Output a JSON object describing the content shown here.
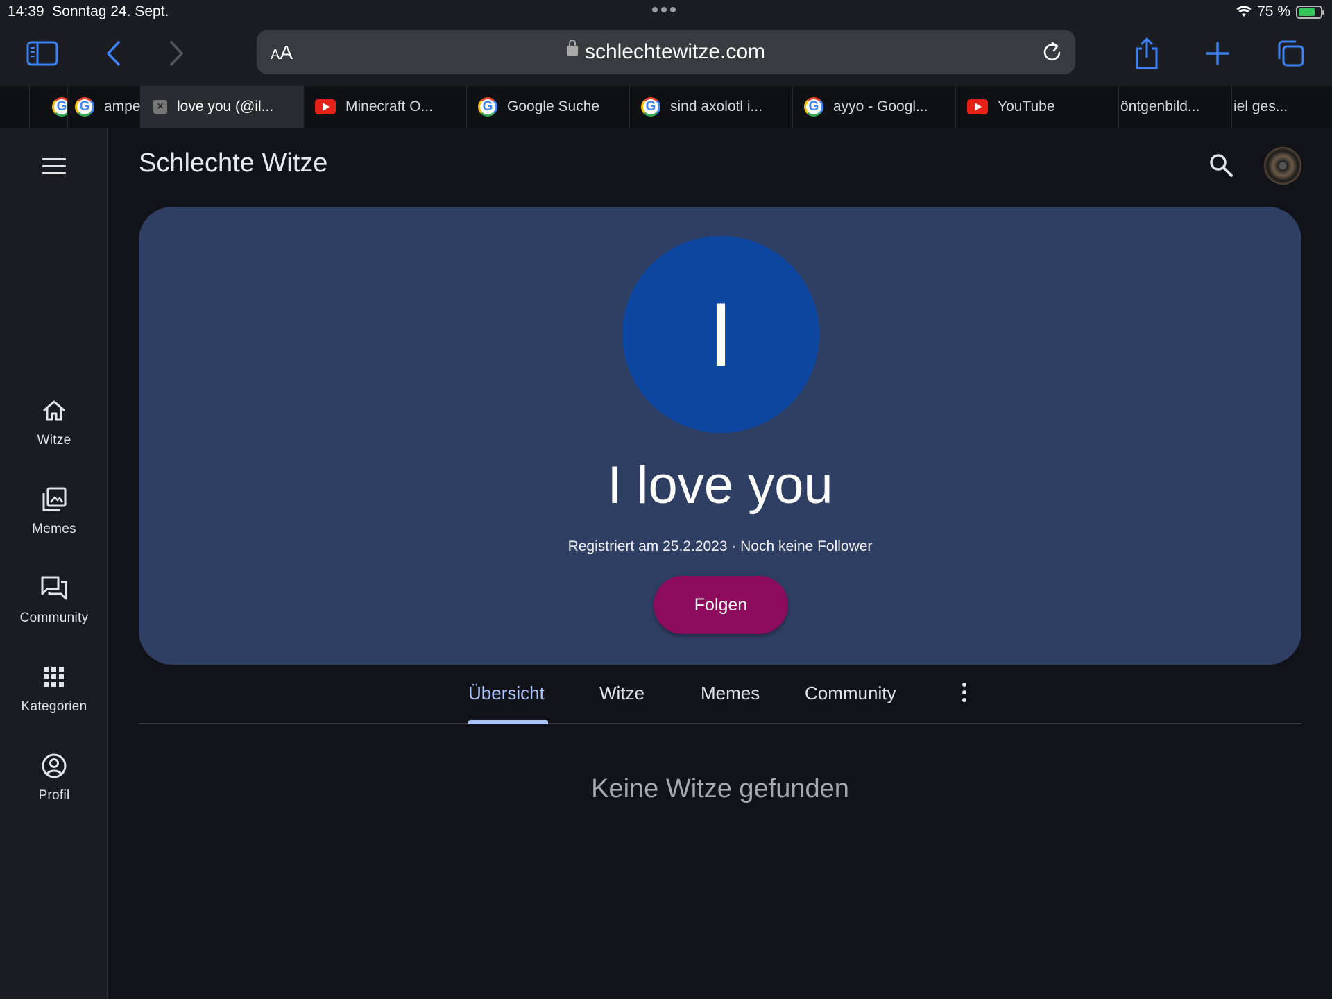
{
  "status_bar": {
    "time": "14:39",
    "date": "Sonntag 24. Sept.",
    "battery": "75 %",
    "battery_level": 0.75
  },
  "browser": {
    "address_text_size": "AA",
    "url": "schlechtewitze.com",
    "tabs": [
      {
        "label": "",
        "icon": "google-icon"
      },
      {
        "label": "ampe",
        "icon": "google-icon"
      },
      {
        "label": "love you (@il...",
        "icon": "close-icon",
        "active": true
      },
      {
        "label": "Minecraft O...",
        "icon": "youtube-icon"
      },
      {
        "label": "Google Suche",
        "icon": "google-icon"
      },
      {
        "label": "sind axolotl i...",
        "icon": "google-icon"
      },
      {
        "label": "ayyo - Googl...",
        "icon": "google-icon"
      },
      {
        "label": "YouTube",
        "icon": "youtube-icon"
      },
      {
        "label": "öntgenbild...",
        "icon": ""
      },
      {
        "label": "iel ges...",
        "icon": ""
      }
    ]
  },
  "sidebar": {
    "items": [
      {
        "label": "Witze",
        "icon": "home-icon"
      },
      {
        "label": "Memes",
        "icon": "image-gallery-icon"
      },
      {
        "label": "Community",
        "icon": "forum-icon"
      },
      {
        "label": "Kategorien",
        "icon": "grid-icon"
      },
      {
        "label": "Profil",
        "icon": "account-circle-icon"
      }
    ]
  },
  "header": {
    "title": "Schlechte Witze"
  },
  "profile": {
    "initial": "I",
    "name": "I love you",
    "meta": "Registriert am 25.2.2023 · Noch keine Follower",
    "follow_label": "Folgen"
  },
  "content_tabs": [
    {
      "label": "Übersicht",
      "active": true
    },
    {
      "label": "Witze"
    },
    {
      "label": "Memes"
    },
    {
      "label": "Community"
    }
  ],
  "empty_message": "Keine Witze gefunden",
  "colors": {
    "accent": "#a9c4ff",
    "banner": "#2f3e63",
    "avatar": "#0d47a1",
    "follow": "#8c0b5c",
    "background": "#121319"
  }
}
